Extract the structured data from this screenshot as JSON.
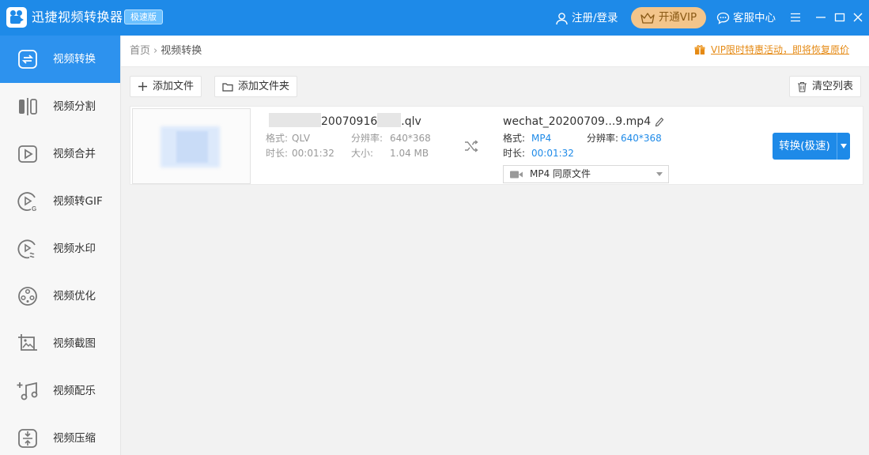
{
  "app": {
    "title": "迅捷视频转换器",
    "edition": "极速版",
    "icon": "app-logo-icon"
  },
  "header": {
    "login_label": "注册/登录",
    "vip_label": "开通VIP",
    "service_label": "客服中心",
    "icons": [
      "user-icon",
      "crown-icon",
      "chat-icon",
      "menu-icon",
      "minimize-icon",
      "maximize-icon",
      "close-icon"
    ]
  },
  "sidebar": {
    "active_index": 0,
    "items": [
      {
        "label": "视频转换",
        "icon": "convert-icon"
      },
      {
        "label": "视频分割",
        "icon": "split-icon"
      },
      {
        "label": "视频合并",
        "icon": "merge-icon"
      },
      {
        "label": "视频转GIF",
        "icon": "gif-icon"
      },
      {
        "label": "视频水印",
        "icon": "watermark-icon"
      },
      {
        "label": "视频优化",
        "icon": "optimize-icon"
      },
      {
        "label": "视频截图",
        "icon": "screenshot-icon"
      },
      {
        "label": "视频配乐",
        "icon": "music-icon"
      },
      {
        "label": "视频压缩",
        "icon": "compress-icon"
      }
    ]
  },
  "breadcrumb": {
    "home": "首页",
    "separator": "›",
    "current": "视频转换"
  },
  "promo": {
    "text": "VIP限时特惠活动，即将恢复原价",
    "icon": "gift-icon"
  },
  "toolbar": {
    "add_file": "添加文件",
    "add_folder": "添加文件夹",
    "clear_list": "清空列表"
  },
  "file": {
    "source": {
      "name_visible": "20070916",
      "name_ext": ".qlv",
      "format_label": "格式:",
      "format": "QLV",
      "resolution_label": "分辨率:",
      "resolution": "640*368",
      "duration_label": "时长:",
      "duration": "00:01:32",
      "size_label": "大小:",
      "size": "1.04 MB"
    },
    "output": {
      "name": "wechat_20200709...9.mp4",
      "format_label": "格式:",
      "format": "MP4",
      "resolution_label": "分辨率:",
      "resolution": "640*368",
      "duration_label": "时长:",
      "duration": "00:01:32",
      "preset": "MP4  同原文件"
    },
    "convert_label": "转换(极速)"
  },
  "colors": {
    "accent": "#1e8ae8",
    "vip": "#f3c58b",
    "promo": "#e58a14"
  }
}
